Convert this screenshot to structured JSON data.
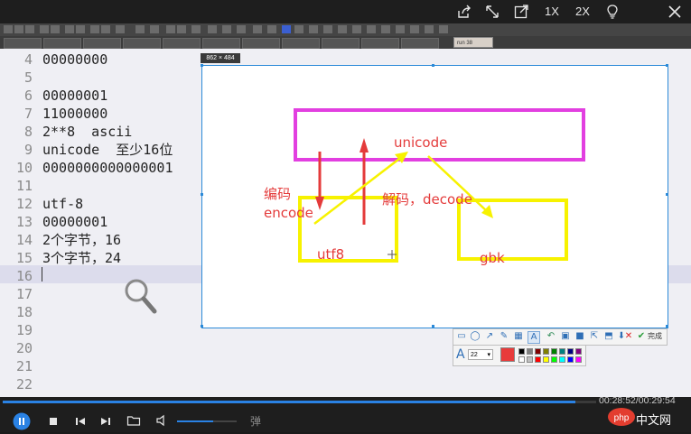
{
  "window": {
    "speed_1x": "1X",
    "speed_2x": "2X"
  },
  "editor": {
    "active_tab": "run 38",
    "lines": [
      {
        "n": "4",
        "text": "00000000"
      },
      {
        "n": "5",
        "text": ""
      },
      {
        "n": "6",
        "text": "00000001"
      },
      {
        "n": "7",
        "text": "11000000"
      },
      {
        "n": "8",
        "text": "2**8  ascii"
      },
      {
        "n": "9",
        "text": "unicode  至少16位"
      },
      {
        "n": "10",
        "text": "0000000000000001"
      },
      {
        "n": "11",
        "text": ""
      },
      {
        "n": "12",
        "text": "utf-8"
      },
      {
        "n": "13",
        "text": "00000001"
      },
      {
        "n": "14",
        "text": "2个字节，16"
      },
      {
        "n": "15",
        "text": "3个字节，24"
      },
      {
        "n": "16",
        "text": ""
      },
      {
        "n": "17",
        "text": ""
      },
      {
        "n": "18",
        "text": ""
      },
      {
        "n": "19",
        "text": ""
      },
      {
        "n": "20",
        "text": ""
      },
      {
        "n": "21",
        "text": ""
      },
      {
        "n": "22",
        "text": ""
      }
    ]
  },
  "screenshot_tool": {
    "size_label": "862 × 484",
    "diagram": {
      "unicode": "unicode",
      "encode_cn": "编码",
      "encode": "encode",
      "decode_label": "解码，decode",
      "utf8": "utf8",
      "gbk": "gbk"
    },
    "colors": {
      "magenta_box": "#e23fe0",
      "yellow": "#f7f200",
      "red_arrow": "#e43b3b",
      "text_red": "#e43b3b"
    },
    "toolbar": {
      "done": "完成",
      "font_size": "22"
    },
    "palette": [
      "#000000",
      "#808080",
      "#800000",
      "#808000",
      "#008000",
      "#008080",
      "#000080",
      "#800080",
      "#ffffff",
      "#c0c0c0",
      "#ff0000",
      "#ffff00",
      "#00ff00",
      "#00ffff",
      "#0000ff",
      "#ff00ff"
    ],
    "selected_color": "#e83b3b"
  },
  "player": {
    "time": "00:28:52/00:29:54",
    "progress_fraction": 0.965,
    "volume_fraction": 0.6,
    "danmu": "弹",
    "logo_text": "中文网",
    "logo_badge": "php"
  }
}
